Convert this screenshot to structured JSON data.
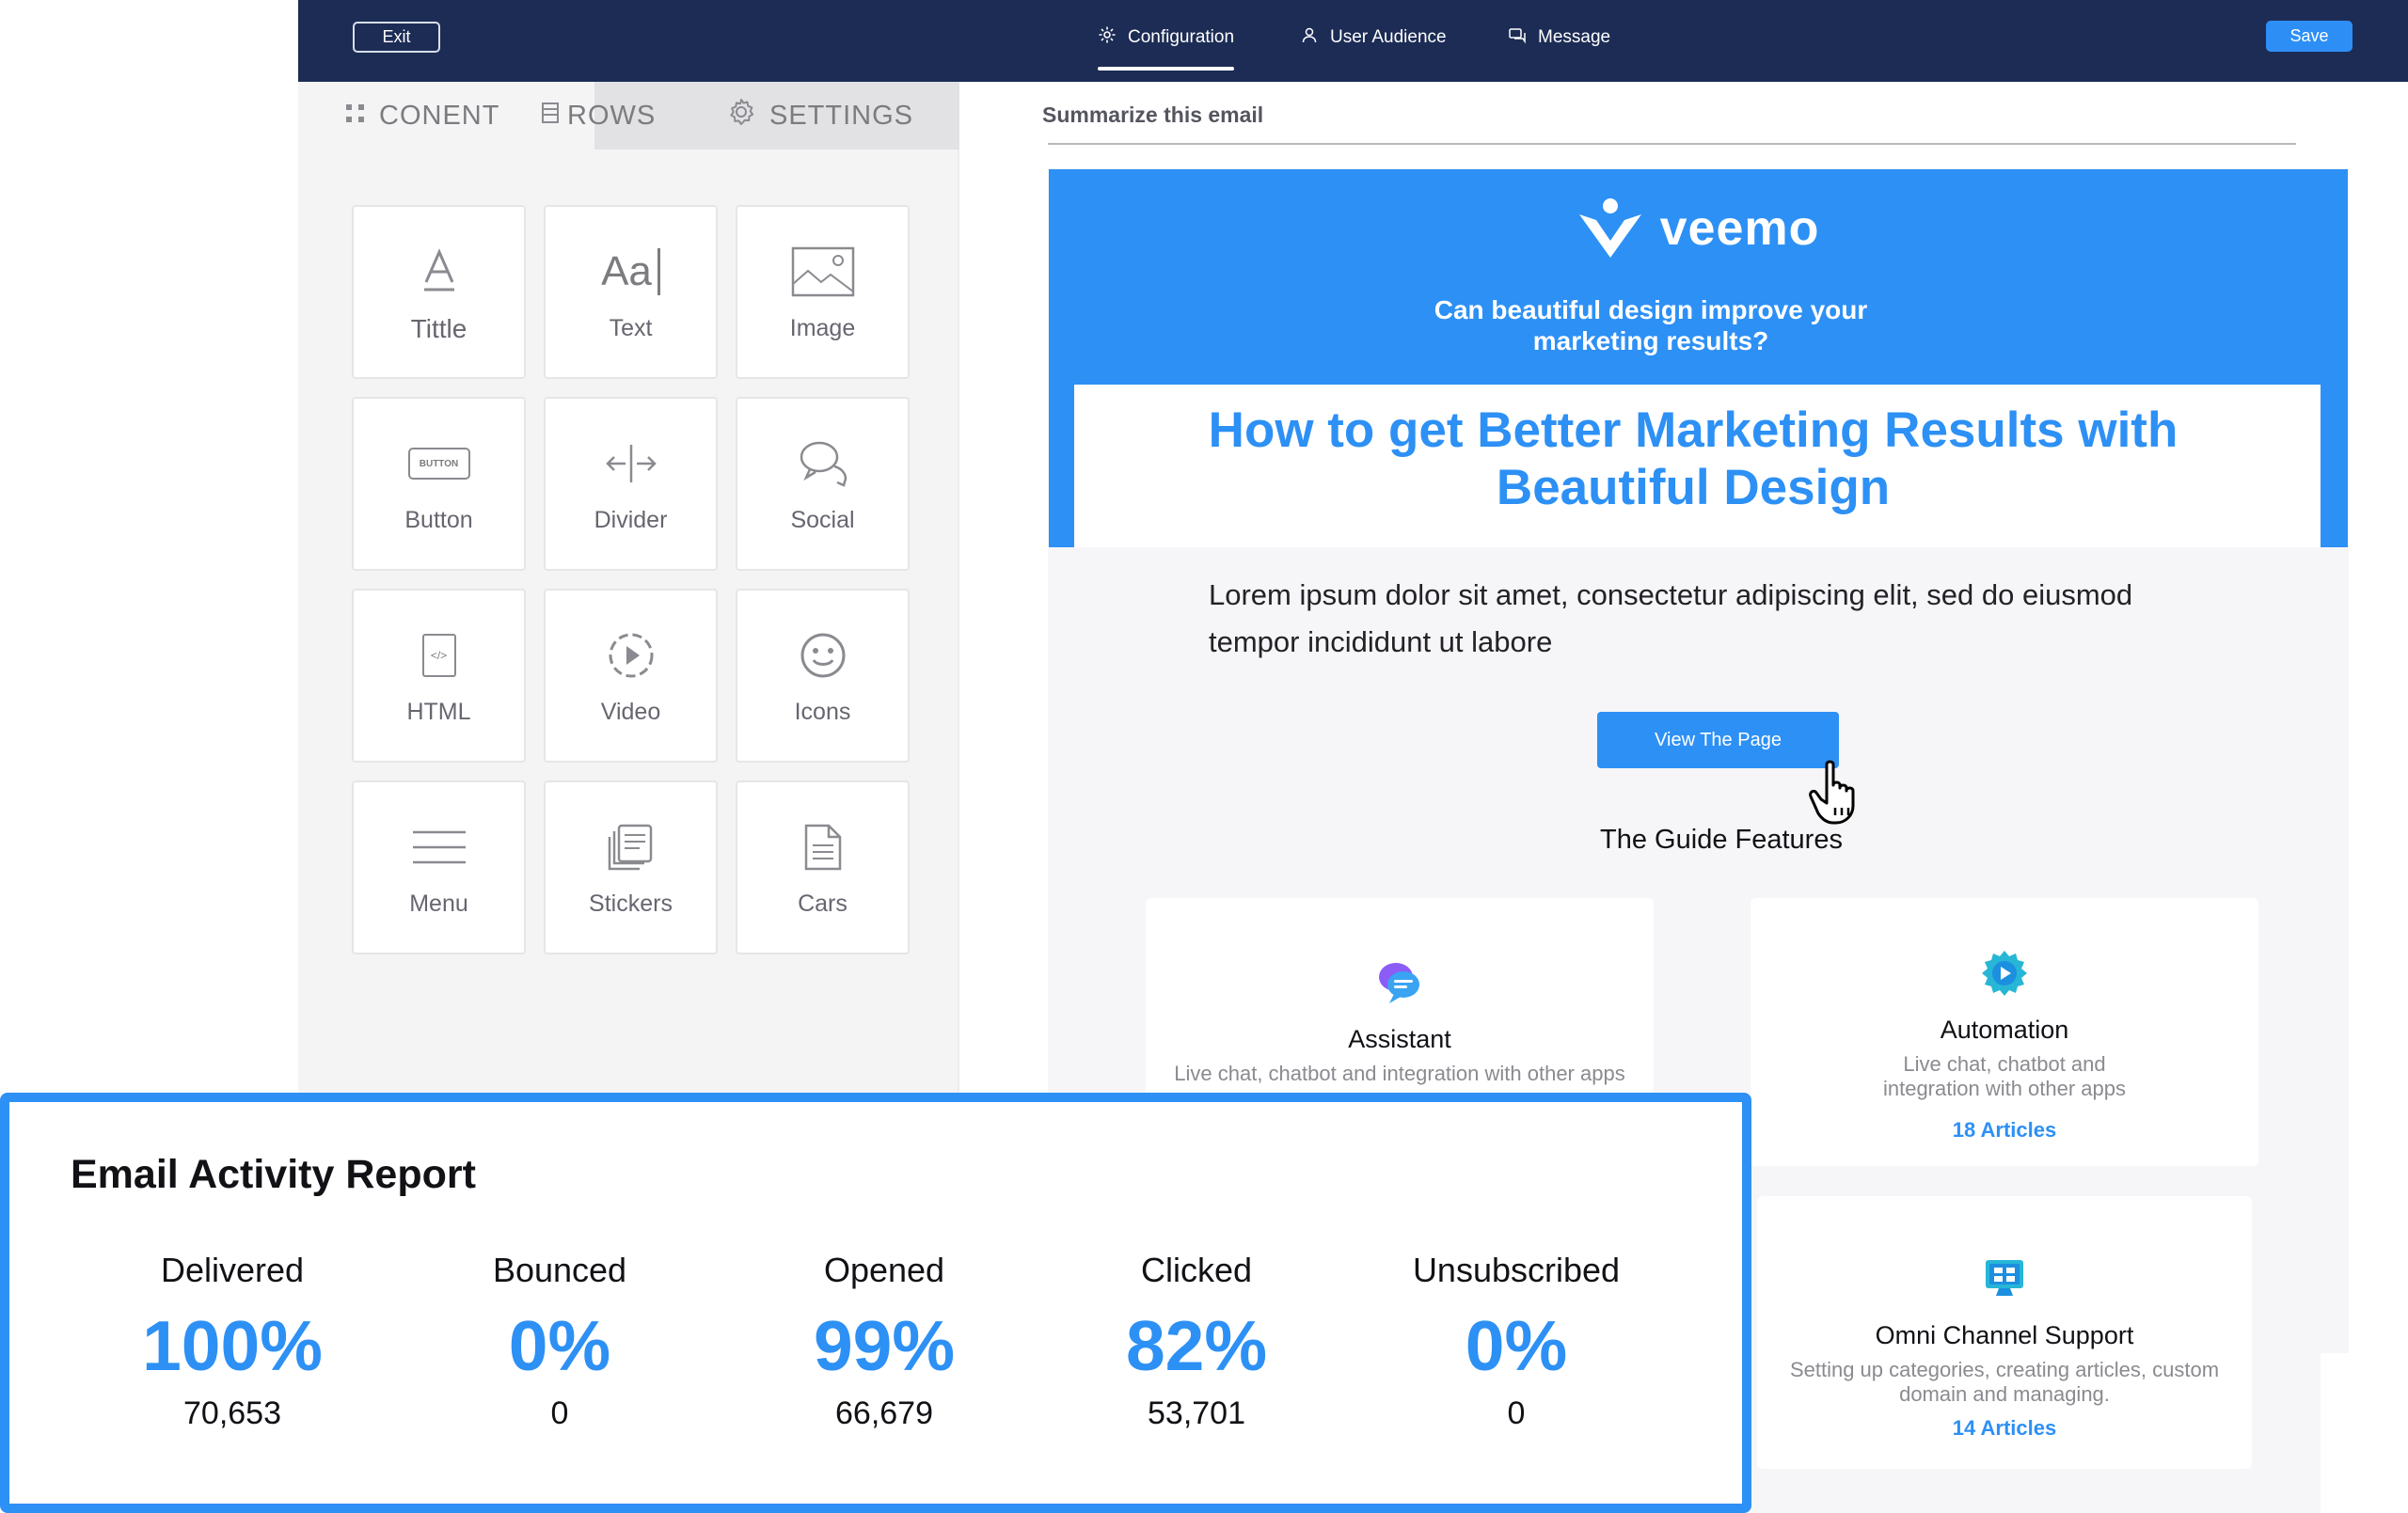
{
  "topbar": {
    "exit_label": "Exit",
    "nav": [
      {
        "label": "Configuration",
        "icon": "gear-icon",
        "active": true
      },
      {
        "label": "User Audience",
        "icon": "user-icon"
      },
      {
        "label": "Message",
        "icon": "message-icon"
      }
    ],
    "save_label": "Save"
  },
  "left_panel": {
    "tabs": [
      {
        "label": "CONENT",
        "icon": "grid-dots-icon",
        "active": true
      },
      {
        "label": "ROWS",
        "icon": "rows-icon"
      },
      {
        "label": "SETTINGS",
        "icon": "gear-icon"
      }
    ],
    "blocks": [
      {
        "label": "Tittle",
        "icon": "title-icon"
      },
      {
        "label": "Text",
        "icon": "text-icon",
        "glyph": "Aa"
      },
      {
        "label": "Image",
        "icon": "image-icon"
      },
      {
        "label": "Button",
        "icon": "button-icon",
        "glyph": "BUTTON"
      },
      {
        "label": "Divider",
        "icon": "divider-icon"
      },
      {
        "label": "Social",
        "icon": "social-icon"
      },
      {
        "label": "HTML",
        "icon": "html-icon",
        "glyph": "</>"
      },
      {
        "label": "Video",
        "icon": "video-icon"
      },
      {
        "label": "Icons",
        "icon": "smiley-icon"
      },
      {
        "label": "Menu",
        "icon": "menu-icon"
      },
      {
        "label": "Stickers",
        "icon": "stickers-icon"
      },
      {
        "label": "Cars",
        "icon": "document-icon"
      }
    ]
  },
  "editor": {
    "summary_label": "Summarize this email",
    "email": {
      "brand": "veemo",
      "tagline": "Can beautiful design improve your marketing results?",
      "headline": "How to get Better Marketing Results with Beautiful Design",
      "body": "Lorem ipsum dolor sit amet, consectetur adipiscing elit, sed do eiusmod tempor incididunt ut labore",
      "cta_label": "View The Page",
      "features_title": "The Guide Features",
      "features": [
        {
          "title": "Assistant",
          "desc": "Live chat, chatbot and integration with other apps",
          "link": "",
          "icon": "chat-bubbles-icon"
        },
        {
          "title": "Automation",
          "desc": "Live chat, chatbot and integration with other apps",
          "link": "18 Articles",
          "icon": "gear-play-icon"
        },
        {
          "title": "Omni Channel Support",
          "desc": "Setting up categories, creating articles, custom domain and managing.",
          "link": "14 Articles",
          "icon": "monitor-icon"
        }
      ]
    }
  },
  "report": {
    "title": "Email Activity Report",
    "metrics": [
      {
        "label": "Delivered",
        "percent": "100%",
        "count": "70,653"
      },
      {
        "label": "Bounced",
        "percent": "0%",
        "count": "0"
      },
      {
        "label": "Opened",
        "percent": "99%",
        "count": "66,679"
      },
      {
        "label": "Clicked",
        "percent": "82%",
        "count": "53,701"
      },
      {
        "label": "Unsubscribed",
        "percent": "0%",
        "count": "0"
      }
    ]
  },
  "colors": {
    "navy": "#1c2c55",
    "accent": "#2d90f5",
    "panel": "#f4f4f5"
  }
}
